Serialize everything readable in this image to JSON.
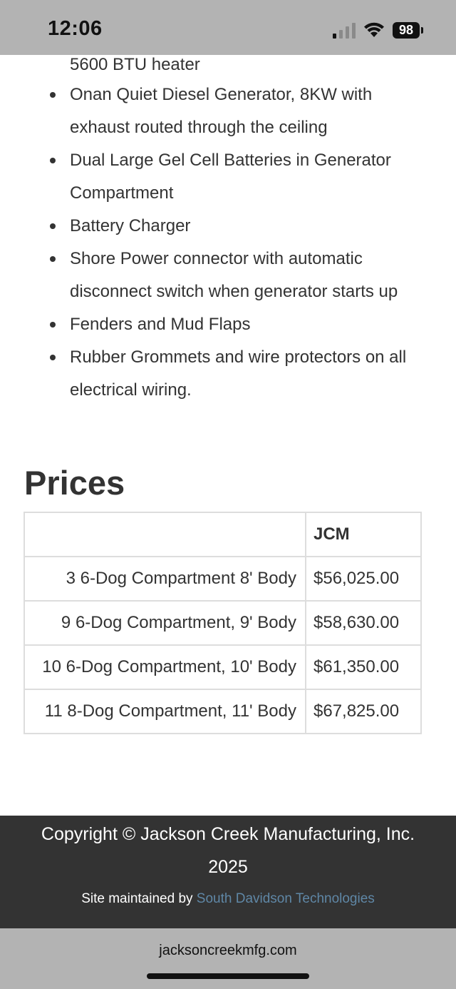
{
  "status_bar": {
    "time": "12:06",
    "battery_level": "98",
    "icons": [
      "signal-icon",
      "wifi-icon",
      "battery-icon"
    ]
  },
  "features": {
    "previous_line": "5600 BTU heater",
    "items": [
      {
        "text": "Onan Quiet Diesel Generator, 8KW with exhaust routed through the ceiling"
      },
      {
        "text": "Dual Large Gel Cell Batteries in Generator Compartment"
      },
      {
        "text": "Battery Charger"
      },
      {
        "text": "Shore Power connector with automatic disconnect switch when generator starts up"
      },
      {
        "text": "Fenders and Mud Flaps"
      },
      {
        "text": "Rubber Grommets and wire protectors on all electrical wiring."
      }
    ]
  },
  "prices": {
    "heading": "Prices",
    "header": {
      "model": "",
      "price": "JCM"
    },
    "rows": [
      {
        "model": "3 6-Dog Compartment 8' Body",
        "price": "$56,025.00"
      },
      {
        "model": "9 6-Dog Compartment, 9' Body",
        "price": "$58,630.00"
      },
      {
        "model": "10 6-Dog Compartment, 10' Body",
        "price": "$61,350.00"
      },
      {
        "model": "11 8-Dog Compartment, 11' Body",
        "price": "$67,825.00"
      }
    ]
  },
  "footer": {
    "copyright": "Copyright © Jackson Creek Manufacturing, Inc. 2025",
    "maintained_prefix": "Site maintained by ",
    "maintained_link": "South Davidson Technologies",
    "link_color": "#5f87a6",
    "background": "#333333"
  },
  "browser": {
    "url": "jacksoncreekmfg.com"
  }
}
